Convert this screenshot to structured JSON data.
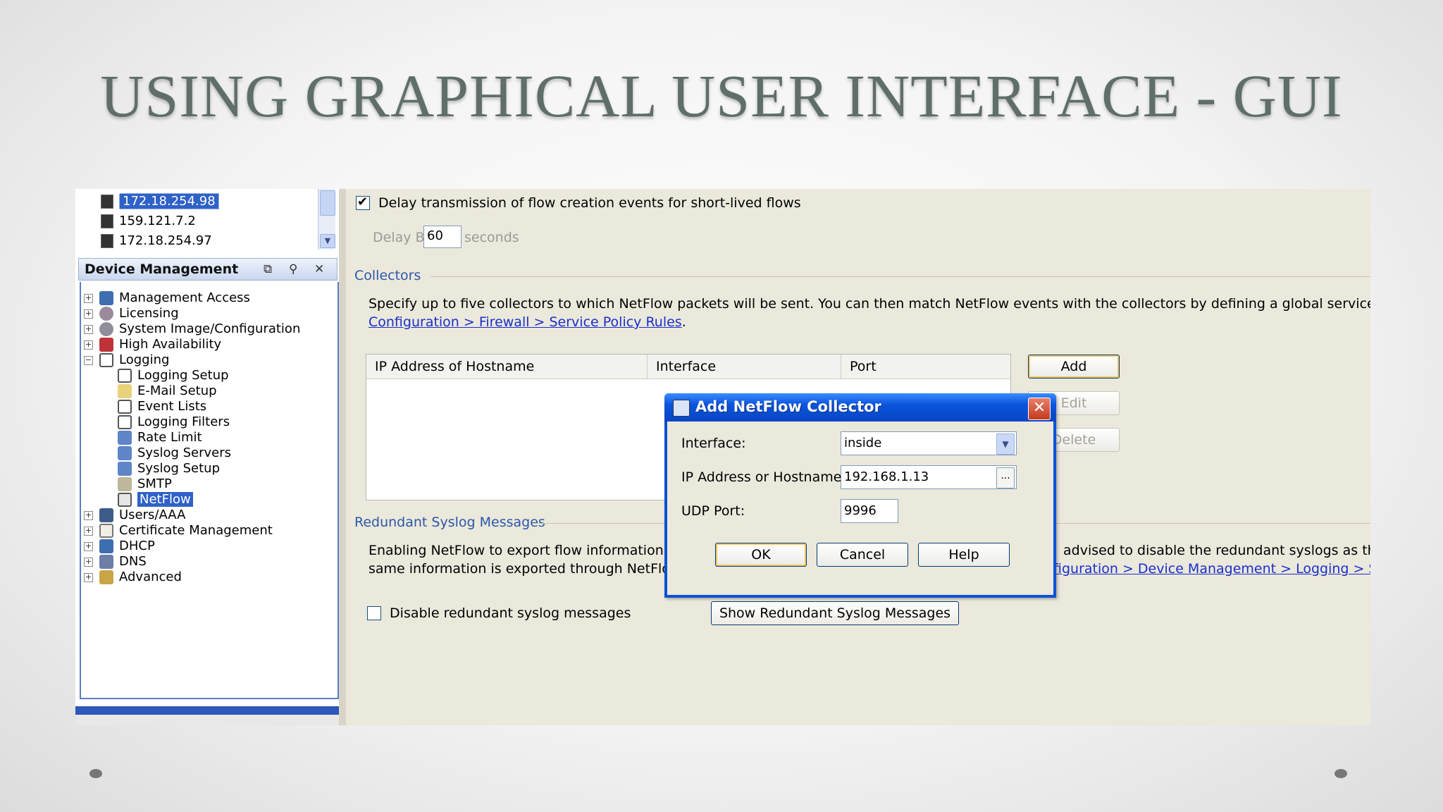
{
  "slide": {
    "title": "USING GRAPHICAL USER INTERFACE - GUI"
  },
  "hosts": [
    {
      "label": "172.18.254.98",
      "selected": true
    },
    {
      "label": "159.121.7.2",
      "selected": false
    },
    {
      "label": "172.18.254.97",
      "selected": false
    }
  ],
  "device_management": {
    "title": "Device Management",
    "items": [
      {
        "label": "Management Access",
        "icon": "management-access-icon"
      },
      {
        "label": "Licensing",
        "icon": "licensing-icon"
      },
      {
        "label": "System Image/Configuration",
        "icon": "system-image-icon"
      },
      {
        "label": "High Availability",
        "icon": "high-availability-icon"
      },
      {
        "label": "Logging",
        "icon": "logging-icon"
      },
      {
        "label": "Logging Setup",
        "icon": "logging-setup-icon"
      },
      {
        "label": "E-Mail Setup",
        "icon": "email-setup-icon"
      },
      {
        "label": "Event Lists",
        "icon": "event-lists-icon"
      },
      {
        "label": "Logging Filters",
        "icon": "logging-filters-icon"
      },
      {
        "label": "Rate Limit",
        "icon": "rate-limit-icon"
      },
      {
        "label": "Syslog Servers",
        "icon": "syslog-servers-icon"
      },
      {
        "label": "Syslog Setup",
        "icon": "syslog-setup-icon"
      },
      {
        "label": "SMTP",
        "icon": "smtp-icon"
      },
      {
        "label": "NetFlow",
        "icon": "netflow-icon"
      },
      {
        "label": "Users/AAA",
        "icon": "users-aaa-icon"
      },
      {
        "label": "Certificate Management",
        "icon": "certificate-icon"
      },
      {
        "label": "DHCP",
        "icon": "dhcp-icon"
      },
      {
        "label": "DNS",
        "icon": "dns-icon"
      },
      {
        "label": "Advanced",
        "icon": "advanced-icon"
      }
    ]
  },
  "netflow": {
    "delay_checkbox_label": "Delay transmission of flow creation events for short-lived flows",
    "delay_checked": true,
    "delay_by_label": "Delay By:",
    "delay_by_value": "60",
    "delay_by_unit": "seconds",
    "collectors_header": "Collectors",
    "collectors_desc": "Specify up to five collectors to which NetFlow packets will be sent. You can then match NetFlow events with the collectors by defining a global service policy rule in",
    "collectors_link": "Configuration > Firewall > Service Policy Rules",
    "collectors_link_suffix": ".",
    "table_columns": [
      "IP Address of Hostname",
      "Interface",
      "Port"
    ],
    "buttons": {
      "add": "Add",
      "edit": "Edit",
      "delete": "Delete"
    },
    "redundant_header": "Redundant Syslog Messages",
    "redundant_line1_a": "Enabling NetFlow to export flow information ma",
    "redundant_line1_b": "advised to disable the redundant syslogs as the",
    "redundant_line2_a": "same information is exported through NetFlow.",
    "redundant_line2_link": "figuration > Device Management > Logging > Sysloc",
    "disable_checkbox_label": "Disable redundant syslog messages",
    "disable_checked": false,
    "show_button": "Show Redundant Syslog Messages"
  },
  "dialog": {
    "title": "Add NetFlow Collector",
    "interface_label": "Interface:",
    "interface_value": "inside",
    "ip_label": "IP Address or Hostname:",
    "ip_value": "192.168.1.13",
    "browse_label": "...",
    "udp_label": "UDP Port:",
    "udp_value": "9996",
    "ok": "OK",
    "cancel": "Cancel",
    "help": "Help"
  },
  "colors": {
    "title": "#5f6e68",
    "selection": "#2f62c8",
    "dialog_titlebar": "#0a54dc",
    "link": "#1a2fc9",
    "section_header": "#2b58a8"
  }
}
